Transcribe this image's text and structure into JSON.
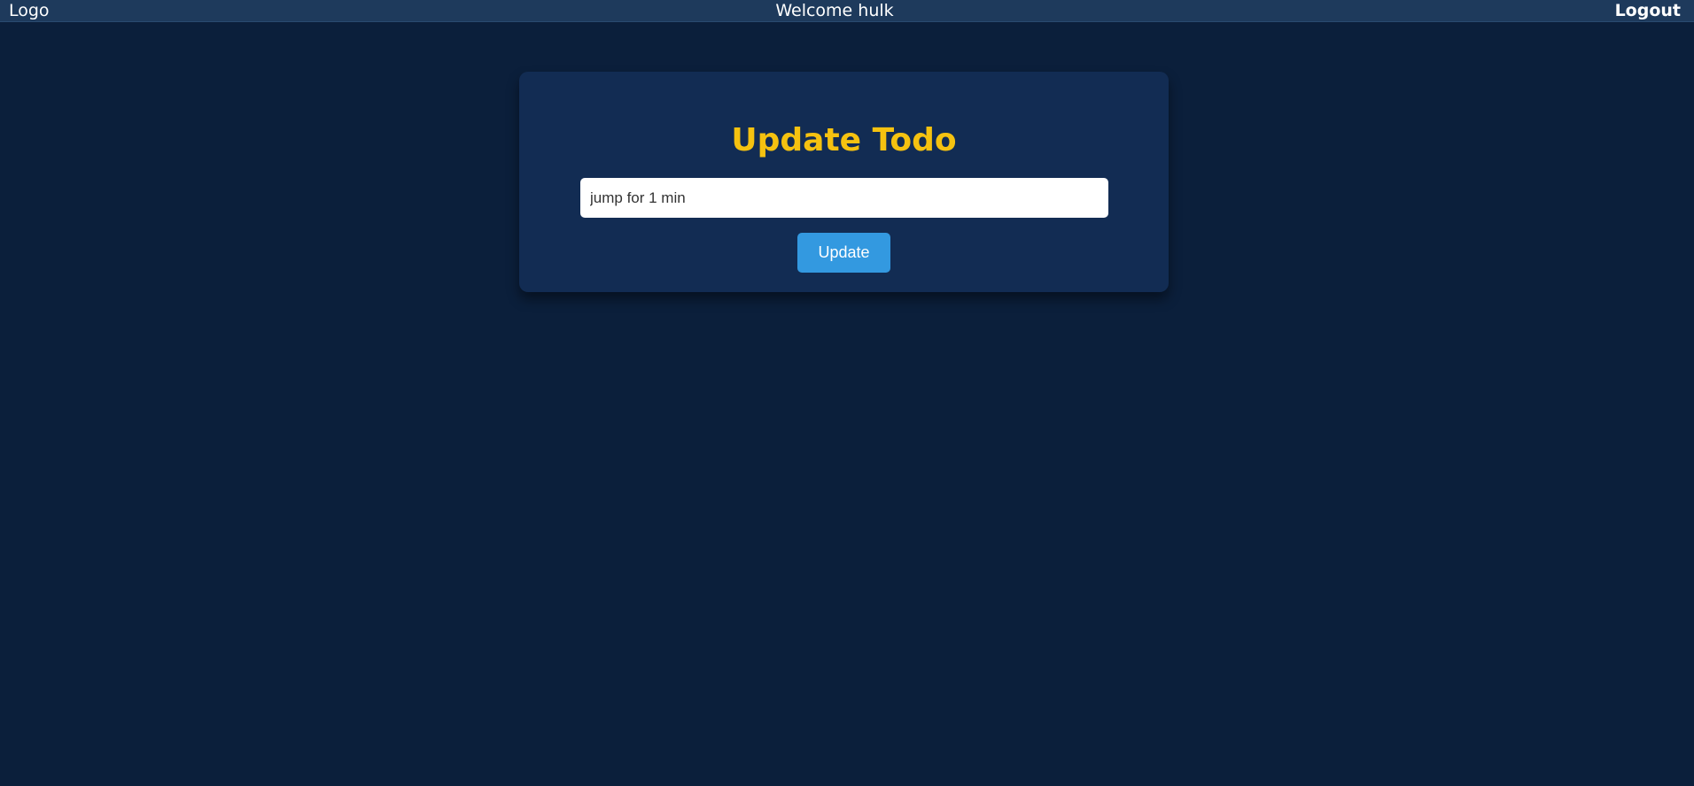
{
  "navbar": {
    "logo": "Logo",
    "welcome": "Welcome hulk",
    "logout": "Logout"
  },
  "card": {
    "title": "Update Todo",
    "input_value": "jump for 1 min",
    "button_label": "Update"
  },
  "colors": {
    "background": "#0b1f3b",
    "navbar": "#1e3a5c",
    "card": "#122c53",
    "title": "#f5c210",
    "button": "#3399e0"
  }
}
